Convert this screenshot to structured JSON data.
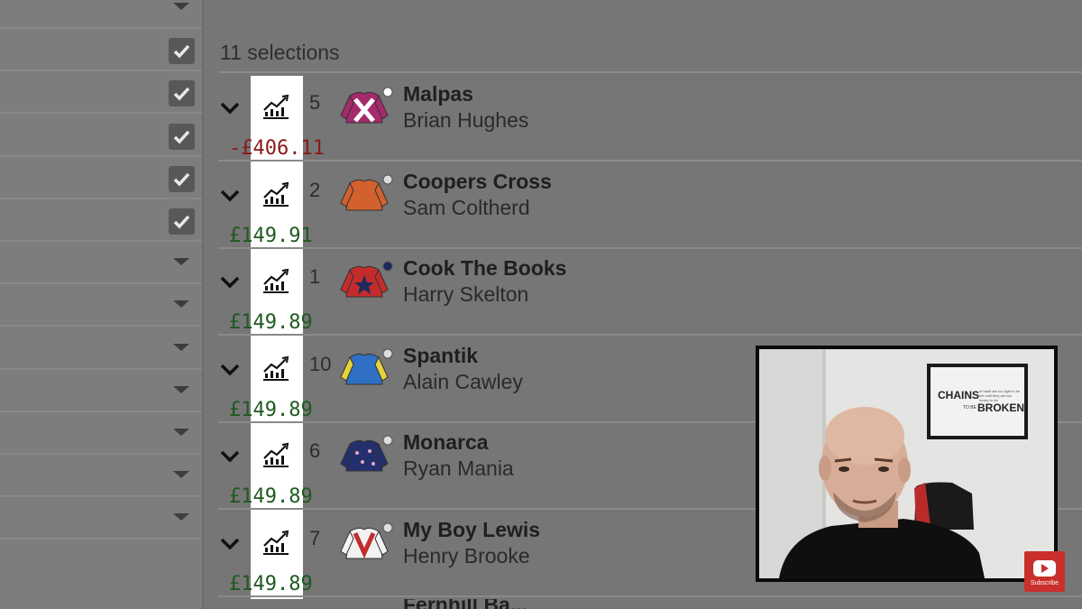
{
  "left_panel": {
    "rows": [
      {
        "control": "caret"
      },
      {
        "control": "checkbox",
        "checked": true
      },
      {
        "control": "checkbox",
        "checked": true
      },
      {
        "control": "checkbox",
        "checked": true
      },
      {
        "control": "checkbox",
        "checked": true
      },
      {
        "control": "checkbox",
        "checked": true
      },
      {
        "control": "caret"
      },
      {
        "control": "caret"
      },
      {
        "control": "caret"
      },
      {
        "control": "caret"
      },
      {
        "control": "caret"
      },
      {
        "control": "caret"
      },
      {
        "control": "caret"
      }
    ]
  },
  "market": {
    "selections_label": "11 selections",
    "runners": [
      {
        "number": "5",
        "horse": "Malpas",
        "jockey": "Brian Hughes",
        "pl": "-£406.11",
        "pl_color": "#8b1a1a",
        "silk": "maroon-white-cross"
      },
      {
        "number": "2",
        "horse": "Coopers Cross",
        "jockey": "Sam Coltherd",
        "pl": "£149.91",
        "pl_color": "#1f5a1f",
        "silk": "orange"
      },
      {
        "number": "1",
        "horse": "Cook The Books",
        "jockey": "Harry Skelton",
        "pl": "£149.89",
        "pl_color": "#1f5a1f",
        "silk": "red-navy-star"
      },
      {
        "number": "10",
        "horse": "Spantik",
        "jockey": "Alain Cawley",
        "pl": "£149.89",
        "pl_color": "#1f5a1f",
        "silk": "blue-yellow"
      },
      {
        "number": "6",
        "horse": "Monarca",
        "jockey": "Ryan Mania",
        "pl": "£149.89",
        "pl_color": "#1f5a1f",
        "silk": "navy-spots"
      },
      {
        "number": "7",
        "horse": "My Boy Lewis",
        "jockey": "Henry Brooke",
        "pl": "£149.89",
        "pl_color": "#1f5a1f",
        "silk": "white-red-chevron"
      }
    ],
    "partial_next_horse": "Fernhill Ba..."
  },
  "webcam": {
    "poster_line1": "CHAINS",
    "poster_line2": "BROKEN",
    "poster_small": "of habit are too light to be felt until they are too heavy to be",
    "poster_to_be": "TO BE"
  },
  "overlay": {
    "subscribe_label": "Subscribe",
    "icon": "youtube-play-icon"
  }
}
